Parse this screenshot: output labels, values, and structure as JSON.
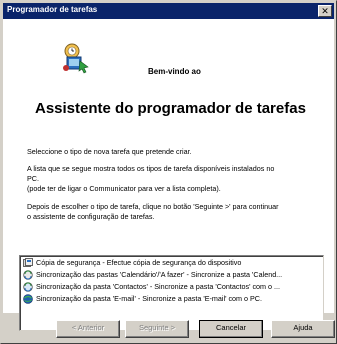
{
  "window": {
    "title": "Programador de tarefas"
  },
  "header": {
    "welcome": "Bem-vindo ao",
    "headline": "Assistente do programador de tarefas"
  },
  "body": {
    "p1": "Seleccione o tipo de nova tarefa que pretende criar.",
    "p2_line1": "A lista que se segue mostra todos os tipos de tarefa disponíveis instalados no",
    "p2_line2": "PC.",
    "p2_line3": "(pode ter de ligar o Communicator para ver a lista completa).",
    "p3_line1": "Depois de escolher o tipo de tarefa, clique no botão 'Seguinte >' para continuar",
    "p3_line2": "o assistente de configuração de tarefas."
  },
  "task_list": [
    {
      "icon": "backup-icon",
      "label": "Cópia de segurança - Efectue cópia de segurança do dispositivo"
    },
    {
      "icon": "calendar-sync-icon",
      "label": "Sincronização das pastas 'Calendário'/'A fazer' - Sincronize a pasta 'Calend..."
    },
    {
      "icon": "contacts-sync-icon",
      "label": "Sincronização da pasta 'Contactos' - Sincronize a pasta 'Contactos' com o ..."
    },
    {
      "icon": "email-sync-icon",
      "label": "Sincronização da pasta 'E-mail' - Sincronize a pasta 'E-mail' com o PC."
    }
  ],
  "buttons": {
    "back": "< Anterior",
    "next": "Seguinte >",
    "cancel": "Cancelar",
    "help": "Ajuda"
  }
}
